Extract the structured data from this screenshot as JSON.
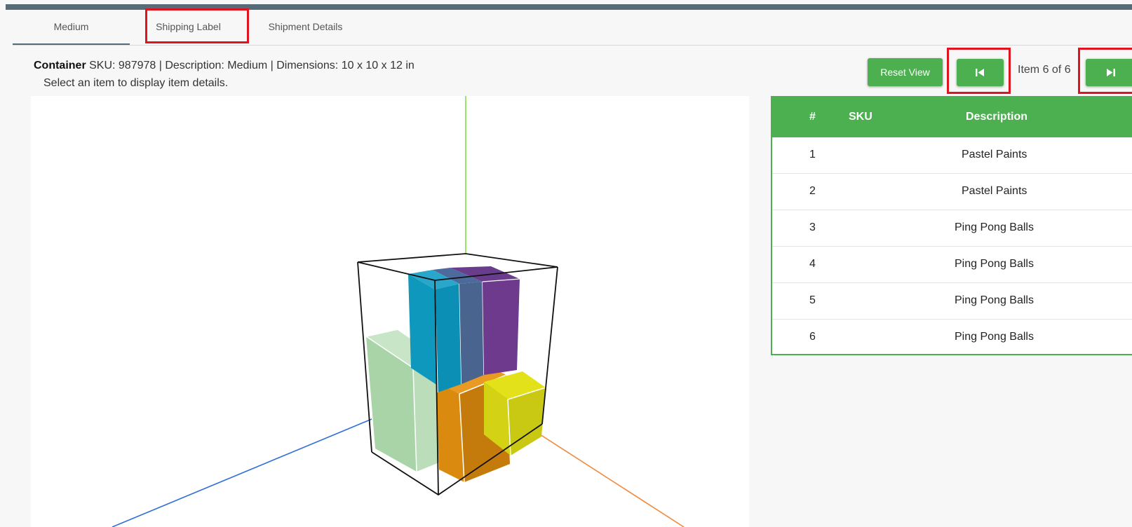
{
  "tabs": [
    {
      "label": "Medium",
      "active": true
    },
    {
      "label": "Shipping Label",
      "active": false
    },
    {
      "label": "Shipment Details",
      "active": false
    }
  ],
  "container": {
    "title": "Container",
    "details": " SKU: 987978 | Description: Medium | Dimensions: 10 x 10 x 12 in",
    "hint": "Select an item to display item details."
  },
  "toolbar": {
    "reset_label": "Reset View",
    "first_icon": "skip-previous-icon",
    "last_icon": "skip-next-icon",
    "counter": "Item 6 of 6"
  },
  "table": {
    "headers": [
      "#",
      "SKU",
      "Description"
    ],
    "rows": [
      {
        "num": "1",
        "sku": "",
        "description": "Pastel Paints"
      },
      {
        "num": "2",
        "sku": "",
        "description": "Pastel Paints"
      },
      {
        "num": "3",
        "sku": "",
        "description": "Ping Pong Balls"
      },
      {
        "num": "4",
        "sku": "",
        "description": "Ping Pong Balls"
      },
      {
        "num": "5",
        "sku": "",
        "description": "Ping Pong Balls"
      },
      {
        "num": "6",
        "sku": "",
        "description": "Ping Pong Balls"
      }
    ]
  },
  "colors": {
    "accent": "#4caf50",
    "topbar": "#566b78",
    "highlight_box": "#e0141e",
    "axis_y": "#7ee04a",
    "axis_x": "#2f6fd6",
    "axis_z": "#f08a3c"
  }
}
